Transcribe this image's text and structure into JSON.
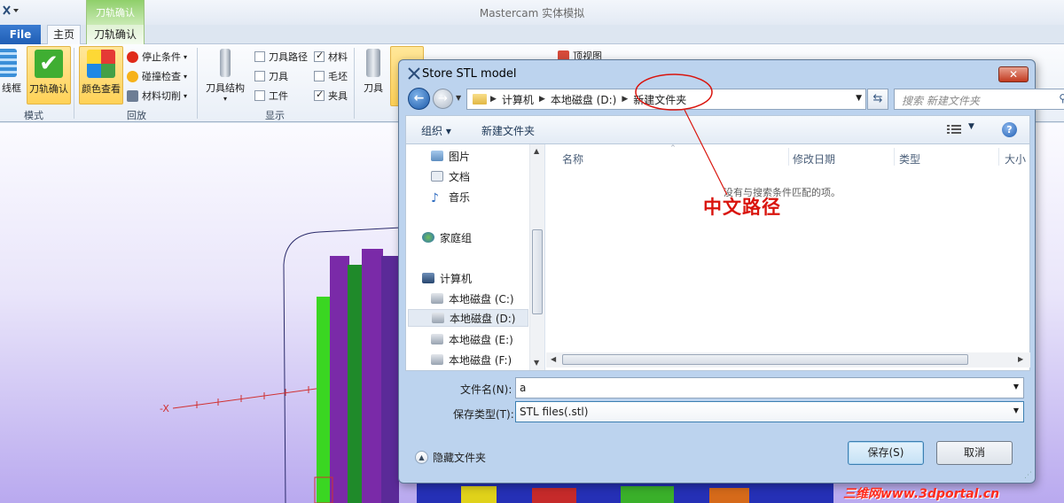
{
  "app": {
    "title": "Mastercam 实体模拟",
    "context_tab_header": "刀轨确认"
  },
  "tabs": {
    "file": "File",
    "home": "主页",
    "context": "刀轨确认"
  },
  "ribbon": {
    "mode": {
      "label": "模式",
      "wireframe": "线框",
      "verify": "刀轨确认"
    },
    "playback": {
      "label": "回放",
      "color_view": "颜色查看",
      "stop_condition": "停止条件",
      "collision_check": "碰撞检查",
      "material_cut": "材料切削"
    },
    "display": {
      "label": "显示",
      "tool_structure": "刀具结构",
      "toolpath": "刀具路径",
      "tool": "刀具",
      "workpiece": "工件",
      "material": "材料",
      "stock": "毛坯",
      "fixture": "夹具"
    },
    "extra": {
      "tool": "刀具",
      "top_view": "顶视图"
    },
    "checks": {
      "toolpath": false,
      "tool": false,
      "workpiece": false,
      "material": true,
      "stock": false,
      "fixture": true
    }
  },
  "dialog": {
    "title": "Store STL model",
    "close": "✕",
    "address": [
      "计算机",
      "本地磁盘 (D:)",
      "新建文件夹"
    ],
    "search_placeholder": "搜索 新建文件夹",
    "toolbar": {
      "organize": "组织 ▾",
      "new_folder": "新建文件夹",
      "help": "?"
    },
    "nav_items": [
      {
        "label": "图片",
        "icon": "pictures-icon"
      },
      {
        "label": "文档",
        "icon": "documents-icon"
      },
      {
        "label": "音乐",
        "icon": "music-icon"
      },
      {
        "label": "家庭组",
        "icon": "homegroup-icon"
      },
      {
        "label": "计算机",
        "icon": "computer-icon"
      },
      {
        "label": "本地磁盘 (C:)",
        "icon": "drive-icon"
      },
      {
        "label": "本地磁盘 (D:)",
        "icon": "drive-icon",
        "selected": true
      },
      {
        "label": "本地磁盘 (E:)",
        "icon": "drive-icon"
      },
      {
        "label": "本地磁盘 (F:)",
        "icon": "drive-icon"
      }
    ],
    "columns": [
      "名称",
      "修改日期",
      "类型",
      "大小"
    ],
    "empty_message": "没有与搜索条件匹配的项。",
    "filename_label": "文件名(N):",
    "filename_value": "a",
    "filetype_label": "保存类型(T):",
    "filetype_value": "STL files(.stl)",
    "hide_folders": "隐藏文件夹",
    "save": "保存(S)",
    "cancel": "取消"
  },
  "annotation": {
    "text": "中文路径",
    "color": "#d9140d"
  },
  "watermark": "三维网www.3dportal.cn",
  "colors": {
    "accent": "#1f5eb5",
    "selection": "#ffd257",
    "viewport_top": "#fbfbff",
    "viewport_bottom": "#b9a9ef"
  }
}
